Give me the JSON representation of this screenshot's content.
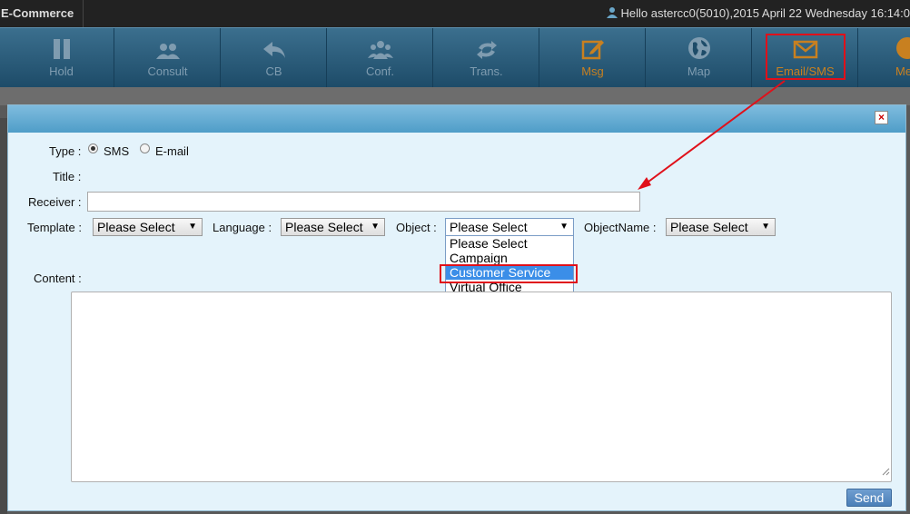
{
  "app": {
    "tab_title": "E-Commerce",
    "greeting": "Hello astercc0(5010),2015 April 22 Wednesday 16:14:0"
  },
  "toolbar": {
    "buttons": [
      {
        "label": "Hold",
        "icon": "pause-icon"
      },
      {
        "label": "Consult",
        "icon": "users-icon"
      },
      {
        "label": "CB",
        "icon": "reply-arrow-icon"
      },
      {
        "label": "Conf.",
        "icon": "group-icon"
      },
      {
        "label": "Trans.",
        "icon": "transfer-icon"
      },
      {
        "label": "Msg",
        "icon": "edit-icon"
      },
      {
        "label": "Map",
        "icon": "globe-icon"
      },
      {
        "label": "Email/SMS",
        "icon": "envelope-icon"
      },
      {
        "label": "Me",
        "icon": "info-icon"
      }
    ],
    "active_color": "#c88020",
    "inactive_color": "#7f9cb0"
  },
  "dialog": {
    "close_label": "×",
    "type_label": "Type :",
    "type_options": [
      "SMS",
      "E-mail"
    ],
    "type_selected": "SMS",
    "title_label": "Title :",
    "receiver_label": "Receiver :",
    "receiver_value": "",
    "template_label": "Template :",
    "template_value": "Please Select",
    "language_label": "Language :",
    "language_value": "Please Select",
    "object_label": "Object :",
    "object_value": "Please Select",
    "object_options": [
      "Please Select",
      "Campaign",
      "Customer Service",
      "Virtual Office"
    ],
    "object_highlighted": "Customer Service",
    "objectname_label": "ObjectName :",
    "objectname_value": "Please Select",
    "content_label": "Content :",
    "content_value": "",
    "send_label": "Send"
  },
  "annotation_color": "#e0101a"
}
